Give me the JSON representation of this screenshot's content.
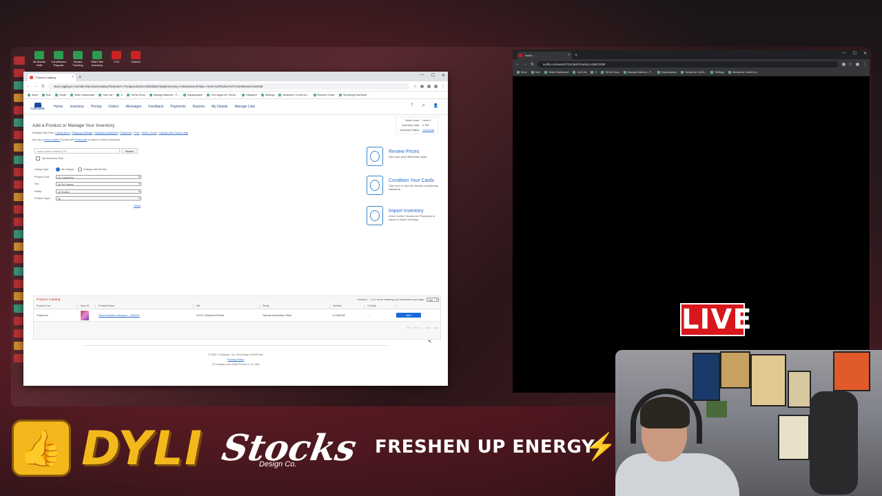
{
  "desktop": {
    "top_icons": [
      "All Brands Stuff",
      "Conditioned Payouts",
      "Sealed Tracking",
      "Wild Pulls Inventory",
      "TCG",
      "Collectr"
    ]
  },
  "left_browser": {
    "tab_title": "Product Catalog",
    "url": "store.tcgplayer.com/admin/product/catalog?dsSearch=True&productId=633038&OnlyMyInventory=False&SearchValue=Team%20Rocket%27s%20Mewtwo%20238",
    "bookmarks": [
      "Work",
      "Kick",
      "Gmail",
      "Seller Dashboard",
      "Cart List",
      "X",
      "TikTok Shop",
      "Manage Batches - P...",
      "Squarespace",
      "Live.vegas for TikTok...",
      "Lifeguard",
      "Settings",
      "Wedseme Credit Uni...",
      "Element Coder",
      "Shopping's NetSuite..."
    ],
    "nav": {
      "logo": "TCGPLAYER",
      "items": [
        "Home",
        "Inventory",
        "Pricing",
        "Orders",
        "Messages",
        "Feedback",
        "Payments",
        "Reports",
        "My Details",
        "Manage Lists"
      ]
    },
    "page": {
      "title": "Add a Product or Manage Your Inventory",
      "help_prefix": "Related Help Files:",
      "help_links": [
        "Listing Items",
        "Shipping Settings",
        "Shipping Guidelines",
        "Payments",
        "Fees",
        "Seller Levels",
        "Listings with Photos Help"
      ],
      "note_prefix": "Are you a",
      "note_link1": "level 4 seller?",
      "note_mid": "Access the",
      "note_link2": "Pricing tab",
      "note_suffix": "to export or import inventory.",
      "seller": {
        "level_label": "Seller Level:",
        "level_value": "Level 4",
        "total_label": "Inventory Total:",
        "total_value": "2,752",
        "status_label": "Inventory Status:",
        "status_value": "Live (Edit)"
      },
      "search": {
        "value": "team rocket's mewtwo 238",
        "button": "Search",
        "checkbox_label": "My Inventory Only"
      },
      "filters": {
        "listing_type_label": "Listing Type:",
        "radio_all": "All Listings",
        "radio_photos": "Listings with Photos",
        "product_line_label": "Product Line:",
        "product_line_value": "All Categories",
        "set_label": "Set:",
        "set_value": "All Set Names",
        "rarity_label": "Rarity:",
        "rarity_value": "All Rarities",
        "product_type_label": "Product Type:",
        "product_type_value": "All",
        "reset": "Reset"
      },
      "promos": [
        {
          "title": "Review Prices",
          "desc": "View your price differential report."
        },
        {
          "title": "Condition Your Cards",
          "desc": "Click here to view the industry conditioning standards."
        },
        {
          "title": "Import Inventory",
          "desc": "Level 4 seller? Access the Pricing tab to export or import inventory."
        }
      ],
      "catalog": {
        "title": "Product Catalog",
        "viewing": "Viewing 1 - 1 of 1 items matching your search",
        "ipp_label": "Items per page:",
        "ipp_value": "250",
        "headers": [
          "Product Line",
          "View ID",
          "Product Name",
          "Set",
          "Rarity",
          "Number",
          "In Stock",
          ""
        ],
        "rows": [
          {
            "line": "Pokemon",
            "name": "Team Rocket's Mewtwo - 238/207",
            "set": "SV10: Destined Rivals",
            "rarity": "Special Illustration Rare",
            "number": "# 238/182",
            "stock": "--",
            "action": "Add"
          }
        ],
        "pager": [
          "First",
          "Prev",
          "1",
          "Next",
          "Last"
        ]
      },
      "footer": {
        "copyright": "© 2025 TCGplayer, Inc. Branching in MIOPrints",
        "privacy": "Privacy Policy",
        "portal": "(TCGplayer.com Seller Portal v.1.11.154)"
      }
    }
  },
  "right_browser": {
    "tab_title": "Netflix",
    "url": "netflix.com/watch/70143649?trackId=155573080",
    "bookmarks": [
      "Work",
      "Kick",
      "Seller Dashboard",
      "Cart List",
      "X",
      "TikTok Shop",
      "Manage Batches - P...",
      "Squarespace",
      "Scripts for 'All lik...",
      "Settings",
      "Wedseme Credit Uni..."
    ]
  },
  "overlay": {
    "live_badge": "LIVE",
    "sponsor_dyli": "DYLI",
    "sponsor_stocks": "Stocks",
    "sponsor_stocks_sub": "Design Co.",
    "sponsor_freshen": "FRESHEN UP ENERGY"
  }
}
